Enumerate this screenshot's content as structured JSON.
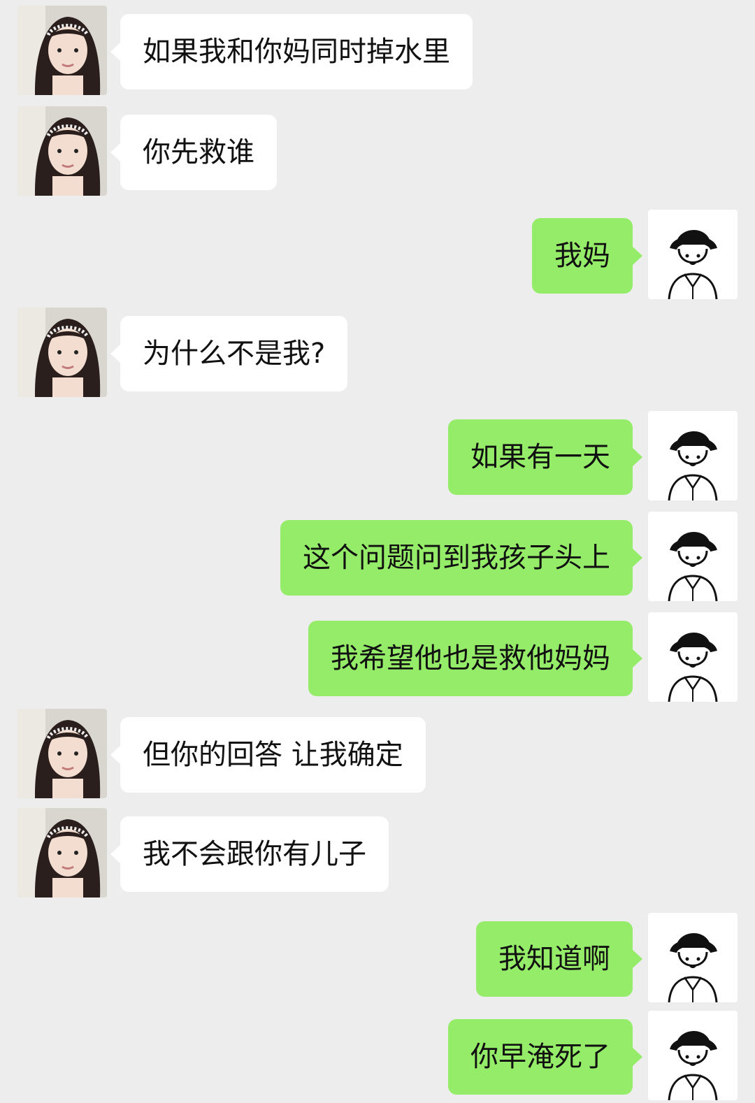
{
  "chat": {
    "messages": [
      {
        "side": "left",
        "text": "如果我和你妈同时掉水里",
        "avatar": "girl-avatar-icon"
      },
      {
        "side": "left",
        "text": "你先救谁",
        "avatar": "girl-avatar-icon"
      },
      {
        "side": "right",
        "text": "我妈",
        "avatar": "boy-avatar-icon"
      },
      {
        "side": "left",
        "text": "为什么不是我?",
        "avatar": "girl-avatar-icon"
      },
      {
        "side": "right",
        "text": "如果有一天",
        "avatar": "boy-avatar-icon"
      },
      {
        "side": "right",
        "text": "这个问题问到我孩子头上",
        "avatar": "boy-avatar-icon"
      },
      {
        "side": "right",
        "text": "我希望他也是救他妈妈",
        "avatar": "boy-avatar-icon"
      },
      {
        "side": "left",
        "text": "但你的回答 让我确定",
        "avatar": "girl-avatar-icon"
      },
      {
        "side": "left",
        "text": "我不会跟你有儿子",
        "avatar": "girl-avatar-icon"
      },
      {
        "side": "right",
        "text": "我知道啊",
        "avatar": "boy-avatar-icon"
      },
      {
        "side": "right",
        "text": "你早淹死了",
        "avatar": "boy-avatar-icon"
      }
    ]
  },
  "colors": {
    "background": "#ededed",
    "self_bubble": "#95ec69",
    "other_bubble": "#ffffff"
  }
}
